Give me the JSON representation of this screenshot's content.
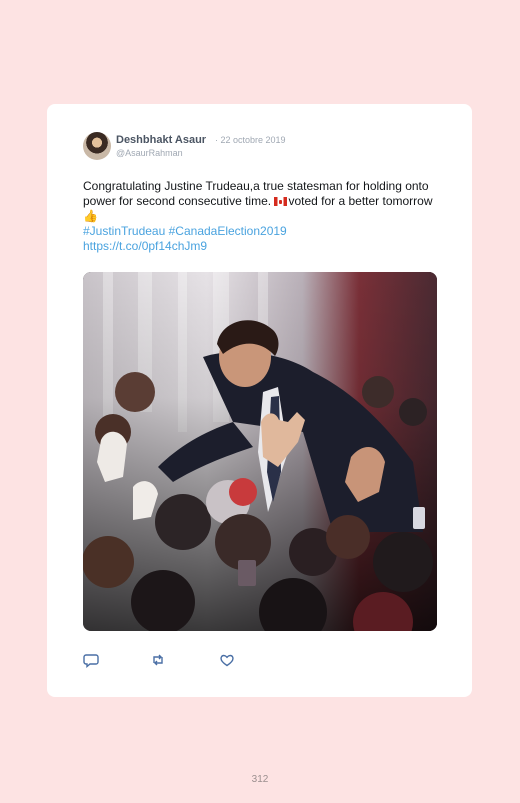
{
  "tweet": {
    "author_name": "Deshbhakt Asaur",
    "date": "· 22 octobre 2019",
    "handle": "@AsaurRahman",
    "text_part1": "Congratulating Justine Trudeau,a true statesman for holding onto power for second consecutive time.",
    "text_part2": "voted for a better tomorrow",
    "thumb_emoji": "👍",
    "hashtag1": "#JustinTrudeau",
    "hashtag2": "#CanadaElection2019",
    "url": "https://t.co/0pf14chJm9"
  },
  "icons": {
    "flag": "canada-flag-icon",
    "reply": "reply-icon",
    "retweet": "retweet-icon",
    "like": "heart-icon"
  },
  "colors": {
    "page_background": "#fde3e3",
    "card_background": "#ffffff",
    "link": "#4aa3df",
    "muted": "#a0a8b3"
  },
  "page": {
    "number": "312"
  }
}
